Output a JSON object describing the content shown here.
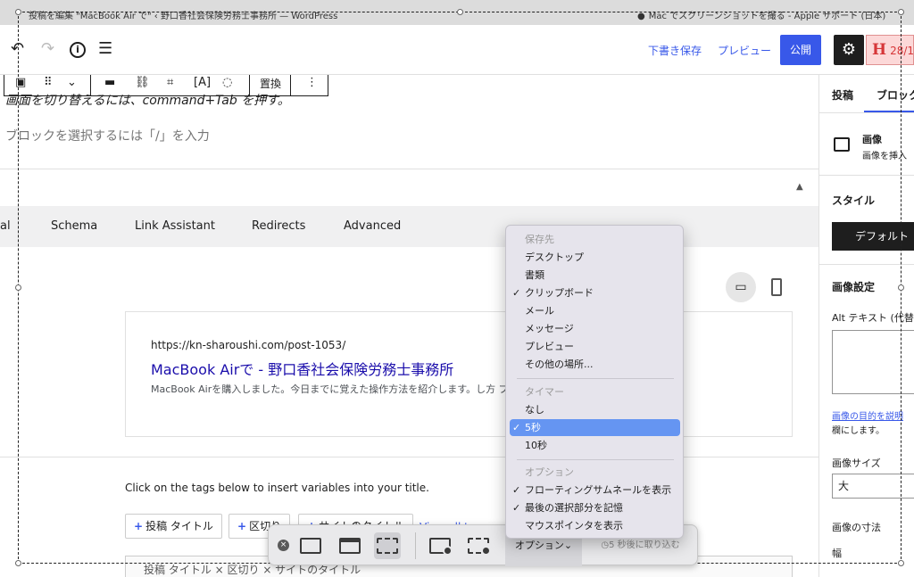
{
  "browser": {
    "tab_left_title": "投稿を編集 \"MacBook Air で\" ‹ 野口香社会保険労務士事務所 — WordPress",
    "tab_right_title": "Mac でスクリーンショットを撮る - Apple サポート (日本)"
  },
  "header": {
    "draft_label": "下書き保存",
    "preview_label": "プレビュー",
    "publish_label": "公開",
    "badge_letter": "H",
    "badge_text": "28/1"
  },
  "block_toolbar": {
    "text_icon_label": "[A]",
    "replace_label": "置換"
  },
  "editor": {
    "paragraph_1": "画面を切り替えるには、command+Tab を押す。",
    "paragraph_placeholder": "ブロックを選択するには「/」を入力"
  },
  "seo": {
    "tabs": [
      "al",
      "Schema",
      "Link Assistant",
      "Redirects",
      "Advanced"
    ],
    "snippet_url": "https://kn-sharoushi.com/post-1053/",
    "snippet_title": "MacBook Airで - 野口香社会保険労務士事務所",
    "snippet_description": "MacBook Airを購入しました。今日までに覚えた操作方法を紹介します。し方 ブ",
    "tags_hint": "Click on the tags below to insert variables into your title.",
    "tag_buttons": [
      "投稿 タイトル",
      "区切り",
      "サイトのタイトル"
    ],
    "view_all_tags": "View all tags →",
    "title_input_preview": "投稿 タイトル ×   区切り ×   サイトのタイトル"
  },
  "sidebar": {
    "tab_post": "投稿",
    "tab_block": "ブロック",
    "block_name": "画像",
    "block_desc": "画像を挿入",
    "style_heading": "スタイル",
    "style_default": "デフォルト",
    "image_settings": "画像設定",
    "alt_label": "Alt テキスト (代替",
    "alt_link": "画像の目的を説明",
    "alt_note": "欄にします。",
    "size_label": "画像サイズ",
    "size_value": "大",
    "dimensions_label": "画像の寸法",
    "width_label": "幅"
  },
  "screenshot_toolbar": {
    "close_icon": "×",
    "options_label": "オプション⌄",
    "capture_label": "◷5 秒後に取り込む",
    "modes": [
      "capture-entire-screen",
      "capture-window",
      "capture-selection",
      "record-entire-screen",
      "record-selection"
    ],
    "active_mode": "capture-selection"
  },
  "options_menu": {
    "save_to_header": "保存先",
    "save_to": [
      "デスクトップ",
      "書類",
      "クリップボード",
      "メール",
      "メッセージ",
      "プレビュー",
      "その他の場所..."
    ],
    "save_to_checked": "クリップボード",
    "timer_header": "タイマー",
    "timer": [
      "なし",
      "5秒",
      "10秒"
    ],
    "timer_selected": "5秒",
    "options_header": "オプション",
    "options": [
      "フローティングサムネールを表示",
      "最後の選択部分を記憶",
      "マウスポインタを表示"
    ],
    "options_checked": [
      "フローティングサムネールを表示",
      "最後の選択部分を記憶"
    ],
    "check_mark": "✓"
  },
  "colors": {
    "wp_blue": "#3858e9",
    "menu_highlight": "#6595f2",
    "link_blue": "#1a0dab"
  }
}
